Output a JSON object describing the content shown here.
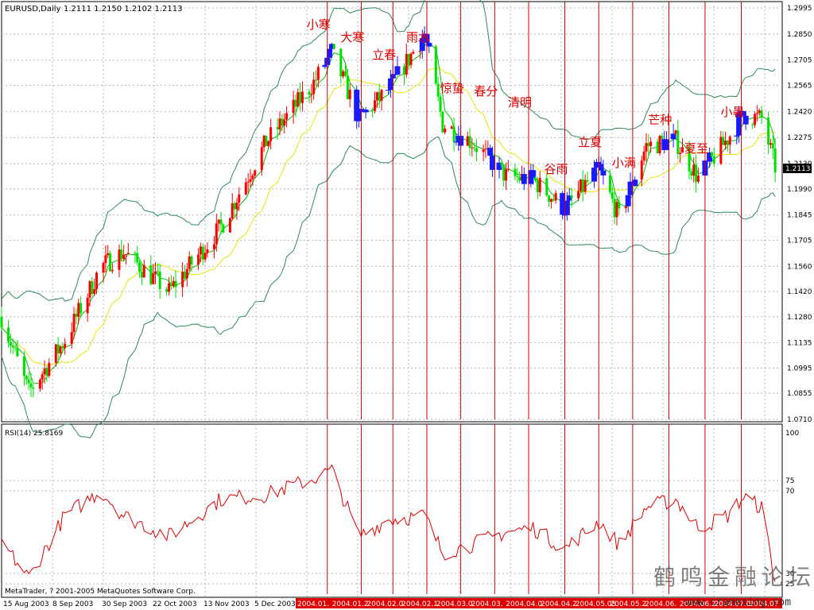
{
  "window": {
    "symbol_label": "EURUSD,Daily",
    "ohlc_label": "1.2111 1.2150 1.2102 1.2113",
    "current_price": "1.2113",
    "copyright": "MetaTrader, ? 2001-2005 MetaQuotes Software Corp.",
    "watermark_cn": "鹤鸣金融论坛",
    "watermark_url": "www.cranesing.com"
  },
  "colors": {
    "bull": "#ff0000",
    "bear": "#00e000",
    "highlight_bar": "#1a1aff",
    "bands": "#2e8b57",
    "ma": "#e6e600",
    "ma_fast": "#00c000",
    "rsi": "#e00000",
    "vline": "#d00000",
    "grid": "#b0b8c0",
    "label_cn": "#e00000"
  },
  "chart_data": {
    "type": "candlestick",
    "instrument": "EURUSD",
    "timeframe": "Daily",
    "price_ticks": [
      "1.2995",
      "1.2850",
      "1.2705",
      "1.2565",
      "1.2420",
      "1.2275",
      "1.2130",
      "1.1990",
      "1.1845",
      "1.1705",
      "1.1560",
      "1.1420",
      "1.1280",
      "1.1135",
      "1.0995",
      "1.0855",
      "1.0710"
    ],
    "ylim": [
      1.071,
      1.2995
    ],
    "date_ticks": [
      "15 Aug 2003",
      "8 Sep 2003",
      "30 Sep 2003",
      "22 Oct 2003",
      "13 Nov 2003",
      "5 Dec 2003"
    ],
    "highlighted_date_ticks": [
      "2004.01.",
      "2004.01.2",
      "2004.02.0",
      "2004.02.1",
      "2004.03.0",
      "2004.03.",
      "2004.04.0",
      "2004.04.2",
      "2004.05.05",
      "2004.05.2",
      "2004.06.",
      "2004.06.2",
      "2004.07.0",
      "2004.07"
    ],
    "trend_points": [
      [
        "2003-08-15",
        1.128
      ],
      [
        "2003-08-27",
        1.086
      ],
      [
        "2003-09-12",
        1.115
      ],
      [
        "2003-09-28",
        1.156
      ],
      [
        "2003-10-08",
        1.164
      ],
      [
        "2003-10-28",
        1.142
      ],
      [
        "2003-11-20",
        1.178
      ],
      [
        "2003-12-10",
        1.225
      ],
      [
        "2003-12-31",
        1.258
      ],
      [
        "2004-01-08",
        1.275
      ],
      [
        "2004-01-20",
        1.238
      ],
      [
        "2004-02-02",
        1.254
      ],
      [
        "2004-02-18",
        1.285
      ],
      [
        "2004-02-26",
        1.235
      ],
      [
        "2004-03-10",
        1.225
      ],
      [
        "2004-03-25",
        1.206
      ],
      [
        "2004-04-06",
        1.204
      ],
      [
        "2004-04-20",
        1.188
      ],
      [
        "2004-05-05",
        1.21
      ],
      [
        "2004-05-14",
        1.183
      ],
      [
        "2004-05-26",
        1.223
      ],
      [
        "2004-06-08",
        1.226
      ],
      [
        "2004-06-18",
        1.205
      ],
      [
        "2004-07-01",
        1.227
      ],
      [
        "2004-07-08",
        1.24
      ],
      [
        "2004-07-16",
        1.238
      ],
      [
        "2004-07-22",
        1.2113
      ]
    ],
    "indicator": {
      "label": "RSI(14) 25.8169",
      "ticks": [
        "100",
        "75",
        "70",
        "30",
        "25"
      ],
      "ylim": [
        20,
        100
      ],
      "trend_points": [
        [
          "2003-08-15",
          45
        ],
        [
          "2003-08-27",
          28
        ],
        [
          "2003-09-12",
          58
        ],
        [
          "2003-09-28",
          70
        ],
        [
          "2003-10-08",
          58
        ],
        [
          "2003-10-28",
          48
        ],
        [
          "2003-11-20",
          66
        ],
        [
          "2003-12-10",
          68
        ],
        [
          "2003-12-31",
          76
        ],
        [
          "2004-01-08",
          80
        ],
        [
          "2004-01-20",
          48
        ],
        [
          "2004-02-02",
          56
        ],
        [
          "2004-02-18",
          58
        ],
        [
          "2004-02-26",
          40
        ],
        [
          "2004-03-10",
          44
        ],
        [
          "2004-03-25",
          50
        ],
        [
          "2004-04-06",
          52
        ],
        [
          "2004-04-20",
          42
        ],
        [
          "2004-05-05",
          55
        ],
        [
          "2004-05-14",
          44
        ],
        [
          "2004-05-26",
          62
        ],
        [
          "2004-06-08",
          66
        ],
        [
          "2004-06-18",
          52
        ],
        [
          "2004-07-01",
          58
        ],
        [
          "2004-07-08",
          67
        ],
        [
          "2004-07-16",
          62
        ],
        [
          "2004-07-22",
          26
        ]
      ]
    },
    "solar_terms": [
      {
        "name": "小寒",
        "date": "2004-01-06"
      },
      {
        "name": "大寒",
        "date": "2004-01-21"
      },
      {
        "name": "立春",
        "date": "2004-02-04"
      },
      {
        "name": "雨水",
        "date": "2004-02-19"
      },
      {
        "name": "惊蛰",
        "date": "2004-03-05"
      },
      {
        "name": "春分",
        "date": "2004-03-20"
      },
      {
        "name": "清明",
        "date": "2004-04-04"
      },
      {
        "name": "谷雨",
        "date": "2004-04-20"
      },
      {
        "name": "立夏",
        "date": "2004-05-05"
      },
      {
        "name": "小满",
        "date": "2004-05-20"
      },
      {
        "name": "芒种",
        "date": "2004-06-05"
      },
      {
        "name": "夏至",
        "date": "2004-06-21"
      },
      {
        "name": "小暑",
        "date": "2004-07-07"
      }
    ]
  }
}
